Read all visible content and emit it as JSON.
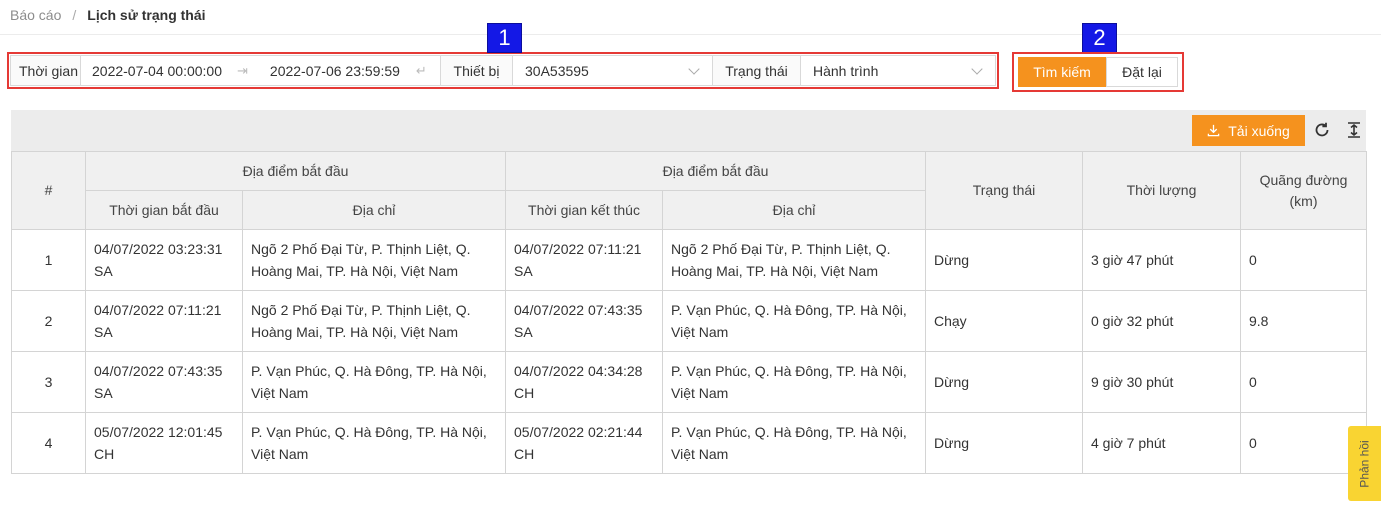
{
  "breadcrumb": {
    "parent": "Báo cáo",
    "separator": "/",
    "current": "Lịch sử trạng thái"
  },
  "markers": {
    "one": "1",
    "two": "2"
  },
  "filters": {
    "time_label": "Thời gian",
    "start_time": "2022-07-04 00:00:00",
    "end_time": "2022-07-06 23:59:59",
    "device_label": "Thiết bị",
    "device_value": "30A53595",
    "status_label": "Trạng thái",
    "status_value": "Hành trình"
  },
  "actions": {
    "search": "Tìm kiếm",
    "reset": "Đặt lại"
  },
  "toolbar": {
    "download": "Tải xuống"
  },
  "table": {
    "headers": {
      "index": "#",
      "group_start": "Địa điểm bắt đầu",
      "start_time": "Thời gian bắt đầu",
      "start_address": "Địa chỉ",
      "group_end": "Địa điểm bắt đầu",
      "end_time": "Thời gian kết thúc",
      "end_address": "Địa chỉ",
      "status": "Trạng thái",
      "duration": "Thời lượng",
      "distance": "Quãng đường (km)"
    },
    "rows": [
      {
        "index": "1",
        "start_time": "04/07/2022 03:23:31 SA",
        "start_address": "Ngõ 2 Phố Đại Từ, P. Thịnh Liệt, Q. Hoàng Mai, TP. Hà Nội, Việt Nam",
        "end_time": "04/07/2022 07:11:21 SA",
        "end_address": "Ngõ 2 Phố Đại Từ, P. Thịnh Liệt, Q. Hoàng Mai, TP. Hà Nội, Việt Nam",
        "status": "Dừng",
        "duration": "3 giờ 47 phút",
        "distance": "0"
      },
      {
        "index": "2",
        "start_time": "04/07/2022 07:11:21 SA",
        "start_address": "Ngõ 2 Phố Đại Từ, P. Thịnh Liệt, Q. Hoàng Mai, TP. Hà Nội, Việt Nam",
        "end_time": "04/07/2022 07:43:35 SA",
        "end_address": "P. Vạn Phúc, Q. Hà Đông, TP. Hà Nội, Việt Nam",
        "status": "Chạy",
        "duration": "0 giờ 32 phút",
        "distance": "9.8"
      },
      {
        "index": "3",
        "start_time": "04/07/2022 07:43:35 SA",
        "start_address": "P. Vạn Phúc, Q. Hà Đông, TP. Hà Nội, Việt Nam",
        "end_time": "04/07/2022 04:34:28 CH",
        "end_address": "P. Vạn Phúc, Q. Hà Đông, TP. Hà Nội, Việt Nam",
        "status": "Dừng",
        "duration": "9 giờ 30 phút",
        "distance": "0"
      },
      {
        "index": "4",
        "start_time": "05/07/2022 12:01:45 CH",
        "start_address": "P. Vạn Phúc, Q. Hà Đông, TP. Hà Nội, Việt Nam",
        "end_time": "05/07/2022 02:21:44 CH",
        "end_address": "P. Vạn Phúc, Q. Hà Đông, TP. Hà Nội, Việt Nam",
        "status": "Dừng",
        "duration": "4 giờ 7 phút",
        "distance": "0"
      }
    ]
  },
  "feedback": "Phản hồi",
  "colors": {
    "accent": "#f5921e",
    "highlight_border": "#e53935",
    "marker": "#1418e6",
    "feedback": "#f9d432"
  },
  "icons": {
    "download": "download-icon",
    "refresh": "refresh-icon",
    "column_height": "column-height-icon",
    "range_arrow": "arrow-right-icon",
    "dropdown": "chevron-down-icon"
  }
}
